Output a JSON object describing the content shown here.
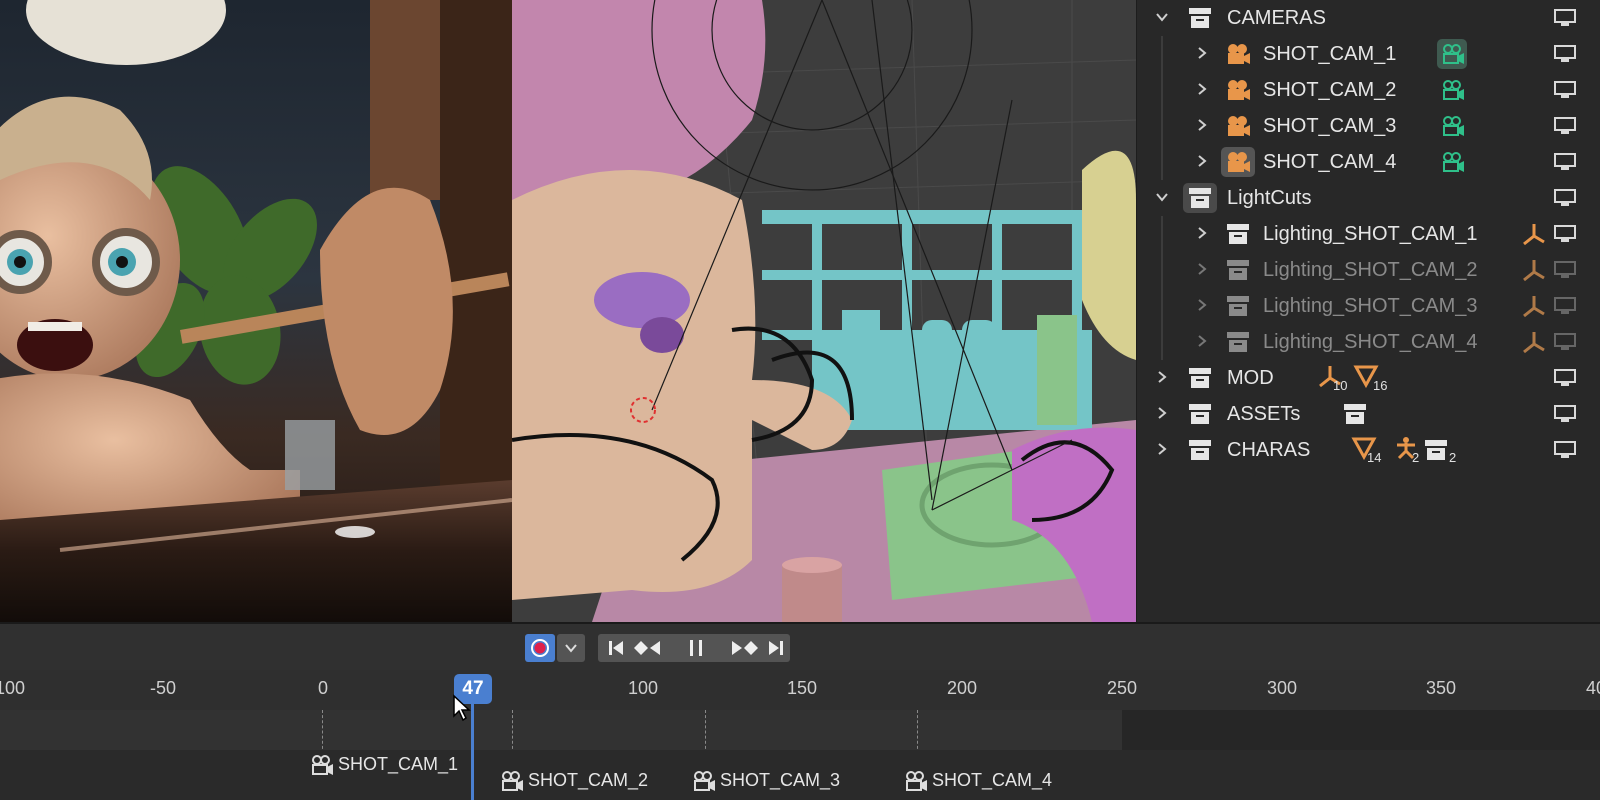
{
  "outliner": {
    "collections": [
      {
        "label": "CAMERAS"
      },
      {
        "label": "LightCuts"
      },
      {
        "label": "MOD",
        "counts": [
          "10",
          "16"
        ]
      },
      {
        "label": "ASSETs"
      },
      {
        "label": "CHARAS",
        "counts": [
          "14",
          "2",
          "2"
        ]
      }
    ],
    "cameras": [
      "SHOT_CAM_1",
      "SHOT_CAM_2",
      "SHOT_CAM_3",
      "SHOT_CAM_4"
    ],
    "lights": [
      "Lighting_SHOT_CAM_1",
      "Lighting_SHOT_CAM_2",
      "Lighting_SHOT_CAM_3",
      "Lighting_SHOT_CAM_4"
    ]
  },
  "timeline": {
    "current_frame": "47",
    "ruler_ticks": [
      "100",
      "-50",
      "0",
      "100",
      "150",
      "200",
      "250",
      "300",
      "350",
      "40"
    ],
    "markers": [
      "SHOT_CAM_1",
      "SHOT_CAM_2",
      "SHOT_CAM_3",
      "SHOT_CAM_4"
    ]
  },
  "colors": {
    "accent": "#4a7fd0",
    "camera": "#e8964a",
    "cam_data": "#2fc08a",
    "record": "#e0204a"
  }
}
